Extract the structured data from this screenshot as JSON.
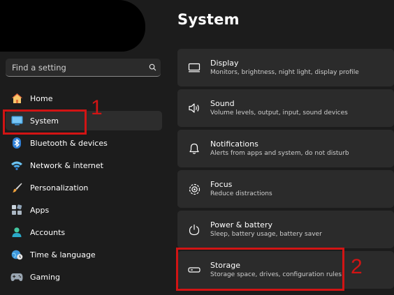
{
  "search": {
    "placeholder": "Find a setting"
  },
  "sidebar": {
    "items": [
      {
        "label": "Home",
        "icon": "home-icon"
      },
      {
        "label": "System",
        "icon": "monitor-icon"
      },
      {
        "label": "Bluetooth & devices",
        "icon": "bluetooth-icon"
      },
      {
        "label": "Network & internet",
        "icon": "wifi-icon"
      },
      {
        "label": "Personalization",
        "icon": "brush-icon"
      },
      {
        "label": "Apps",
        "icon": "apps-icon"
      },
      {
        "label": "Accounts",
        "icon": "person-icon"
      },
      {
        "label": "Time & language",
        "icon": "globe-clock-icon"
      },
      {
        "label": "Gaming",
        "icon": "gamepad-icon"
      }
    ],
    "active": "System"
  },
  "main": {
    "title": "System",
    "cards": [
      {
        "title": "Display",
        "desc": "Monitors, brightness, night light, display profile",
        "icon": "display-icon"
      },
      {
        "title": "Sound",
        "desc": "Volume levels, output, input, sound devices",
        "icon": "speaker-icon"
      },
      {
        "title": "Notifications",
        "desc": "Alerts from apps and system, do not disturb",
        "icon": "bell-icon"
      },
      {
        "title": "Focus",
        "desc": "Reduce distractions",
        "icon": "focus-icon"
      },
      {
        "title": "Power & battery",
        "desc": "Sleep, battery usage, battery saver",
        "icon": "power-icon"
      },
      {
        "title": "Storage",
        "desc": "Storage space, drives, configuration rules",
        "icon": "storage-icon"
      }
    ]
  },
  "annotations": {
    "label_1": "1",
    "label_2": "2",
    "color": "#d21414"
  }
}
